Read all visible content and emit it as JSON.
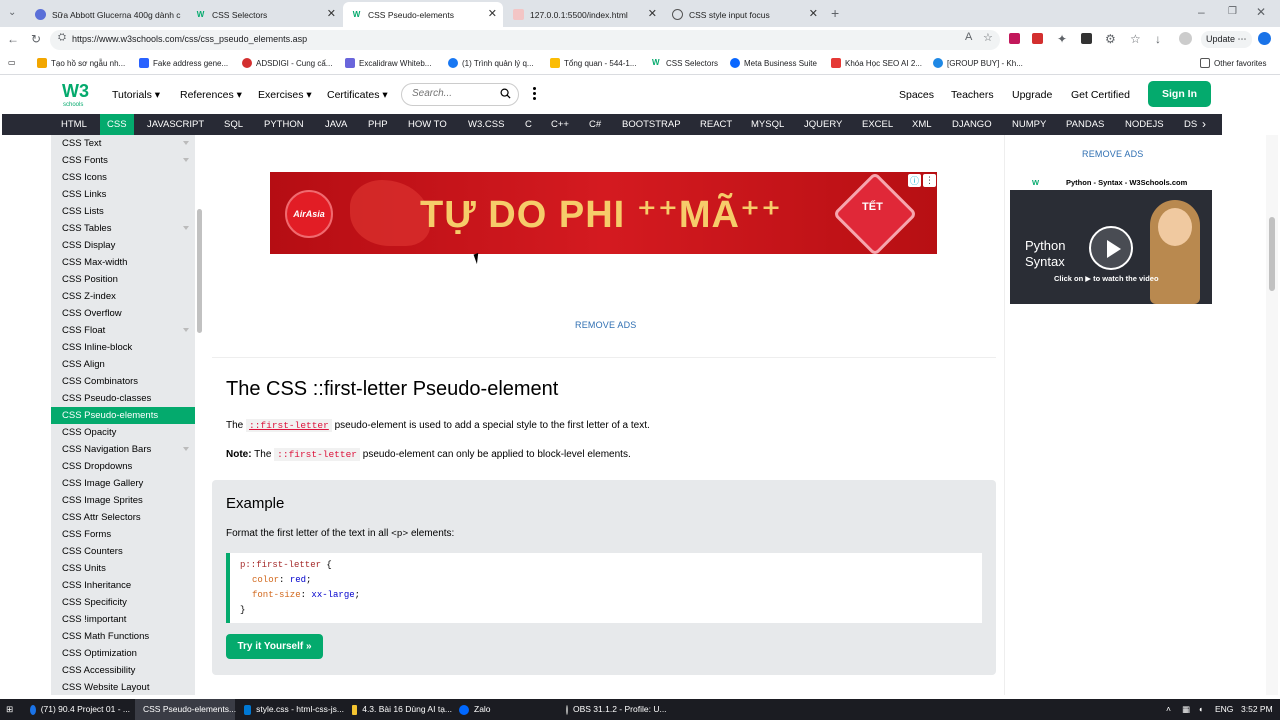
{
  "browser": {
    "tabs": [
      {
        "title": "Sữa Abbott Glucerna 400g dành c",
        "icon_color": "#5a6fd8"
      },
      {
        "title": "CSS Selectors",
        "icon_color": "#04AA6D"
      },
      {
        "title": "CSS Pseudo-elements",
        "icon_color": "#04AA6D",
        "active": true
      },
      {
        "title": "127.0.0.1:5500/index.html",
        "icon_color": "#e66"
      },
      {
        "title": "CSS style input focus",
        "icon_color": "#555"
      }
    ],
    "url": "https://www.w3schools.com/css/css_pseudo_elements.asp",
    "update_label": "Update",
    "bookmarks": [
      "Tạo hồ sơ ngẫu nh...",
      "Fake address gene...",
      "ADSDIGI - Cung cấ...",
      "Excalidraw Whiteb...",
      "(1) Trình quản lý q...",
      "Tổng quan - 544-1...",
      "CSS Selectors",
      "Meta Business Suite",
      "Khóa Học SEO AI 2...",
      "[GROUP BUY] - Kh..."
    ],
    "other_favorites": "Other favorites"
  },
  "header": {
    "logo_text": "W3",
    "logo_sub": "schools",
    "menu": [
      "Tutorials",
      "References",
      "Exercises",
      "Certificates"
    ],
    "search_placeholder": "Search...",
    "right_links": [
      "Spaces",
      "Teachers",
      "Upgrade",
      "Get Certified"
    ],
    "signin": "Sign In"
  },
  "topnav": [
    "HTML",
    "CSS",
    "JAVASCRIPT",
    "SQL",
    "PYTHON",
    "JAVA",
    "PHP",
    "HOW TO",
    "W3.CSS",
    "C",
    "C++",
    "C#",
    "BOOTSTRAP",
    "REACT",
    "MYSQL",
    "JQUERY",
    "EXCEL",
    "XML",
    "DJANGO",
    "NUMPY",
    "PANDAS",
    "NODEJS",
    "DS"
  ],
  "sidebar": [
    "CSS Text",
    "CSS Fonts",
    "CSS Icons",
    "CSS Links",
    "CSS Lists",
    "CSS Tables",
    "CSS Display",
    "CSS Max-width",
    "CSS Position",
    "CSS Z-index",
    "CSS Overflow",
    "CSS Float",
    "CSS Inline-block",
    "CSS Align",
    "CSS Combinators",
    "CSS Pseudo-classes",
    "CSS Pseudo-elements",
    "CSS Opacity",
    "CSS Navigation Bars",
    "CSS Dropdowns",
    "CSS Image Gallery",
    "CSS Image Sprites",
    "CSS Attr Selectors",
    "CSS Forms",
    "CSS Counters",
    "CSS Units",
    "CSS Inheritance",
    "CSS Specificity",
    "CSS !important",
    "CSS Math Functions",
    "CSS Optimization",
    "CSS Accessibility",
    "CSS Website Layout"
  ],
  "ad": {
    "brand": "AirAsia",
    "headline": "TỰ DO PHI ⁺⁺MÃ⁺⁺",
    "tet": "TẾT",
    "remove_ads": "REMOVE ADS"
  },
  "content": {
    "title": "The CSS ::first-letter Pseudo-element",
    "p1_before": "The ",
    "p1_code": "::first-letter",
    "p1_after": " pseudo-element is used to add a special style to the first letter of a text.",
    "note_label": "Note:",
    "note_before": " The ",
    "note_code": "::first-letter",
    "note_after": " pseudo-element can only be applied to block-level elements.",
    "example_title": "Example",
    "example_desc_before": "Format the first letter of the text in all ",
    "example_desc_tag": "<p>",
    "example_desc_after": " elements:",
    "code": {
      "selector": "p::first-letter",
      "open": " {",
      "prop1": "color",
      "val1": " red",
      "prop2": "font-size",
      "val2": " xx-large",
      "close": "}"
    },
    "try_button": "Try it Yourself »"
  },
  "right": {
    "remove_ads": "REMOVE ADS",
    "video_title": "Python - Syntax - W3Schools.com",
    "video_text_1": "Python",
    "video_text_2": "Syntax",
    "video_caption": "Click on ▶ to watch the video"
  },
  "taskbar": {
    "items": [
      "(71) 90.4 Project 01 - ...",
      "CSS Pseudo-elements...",
      "style.css - html-css-js...",
      "4.3. Bài 16 Dùng AI tạ...",
      "Zalo",
      "OBS 31.1.2 - Profile: U..."
    ],
    "lang": "ENG",
    "time": "3:52 PM"
  }
}
